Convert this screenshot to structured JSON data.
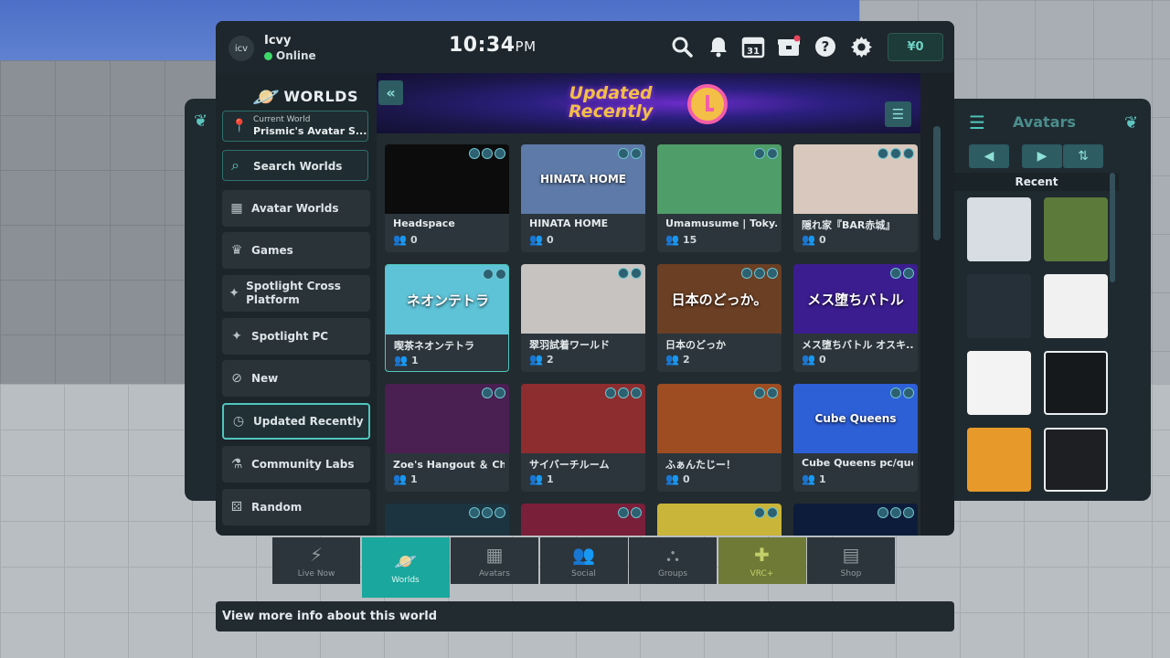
{
  "user": {
    "avatar_initials": "icv",
    "name": "Icvy",
    "status": "Online"
  },
  "clock": {
    "time": "10:34",
    "ampm": "PM"
  },
  "topbar": {
    "icons": [
      "search-icon",
      "bell-icon",
      "calendar-icon",
      "inventory-icon",
      "help-icon",
      "gear-icon"
    ],
    "calendar_day": "31",
    "credits": "0"
  },
  "sidebar": {
    "title": "WORLDS",
    "current_world_label": "Current World",
    "current_world_value": "Prismic's Avatar S...",
    "search_label": "Search Worlds",
    "items": [
      {
        "label": "Avatar Worlds",
        "icon": "book-icon",
        "active": false
      },
      {
        "label": "Games",
        "icon": "crown-icon",
        "active": false
      },
      {
        "label": "Spotlight Cross Platform",
        "icon": "spotlight-icon",
        "active": false
      },
      {
        "label": "Spotlight PC",
        "icon": "spotlight-icon",
        "active": false
      },
      {
        "label": "New",
        "icon": "new-icon",
        "active": false
      },
      {
        "label": "Updated Recently",
        "icon": "history-icon",
        "active": true
      },
      {
        "label": "Community Labs",
        "icon": "flask-icon",
        "active": false
      },
      {
        "label": "Random",
        "icon": "dice-icon",
        "active": false
      }
    ]
  },
  "banner": {
    "title_line1": "Updated",
    "title_line2": "Recently"
  },
  "worlds": [
    {
      "name": "Headspace",
      "count": "0",
      "thumb_text": "",
      "bg": "#0c0c0d"
    },
    {
      "name": "HINATA HOME",
      "count": "0",
      "thumb_text": "HINATA HOME",
      "bg": "#5d7aa8"
    },
    {
      "name": "Umamusume | Toky...",
      "count": "15",
      "thumb_text": "",
      "bg": "#4f9d68"
    },
    {
      "name": "隠れ家『BAR赤城』",
      "count": "0",
      "thumb_text": "",
      "bg": "#d9c8bd"
    },
    {
      "name": "喫茶ネオンテトラ",
      "count": "1",
      "thumb_text": "ネオンテトラ",
      "bg": "#5fc3d8"
    },
    {
      "name": "翠羽試着ワールド",
      "count": "2",
      "thumb_text": "",
      "bg": "#c7c3c0"
    },
    {
      "name": "日本のどっか",
      "count": "2",
      "thumb_text": "日本のどっか。",
      "bg": "#6b3f24"
    },
    {
      "name": "メス堕ちバトル オスキ...",
      "count": "0",
      "thumb_text": "メス堕ちバトル",
      "bg": "#3b1d8f"
    },
    {
      "name": "Zoe's Hangout ＆ Chill",
      "count": "1",
      "thumb_text": "",
      "bg": "#4a1f52"
    },
    {
      "name": "サイバーチルーム",
      "count": "1",
      "thumb_text": "",
      "bg": "#8e2d2f"
    },
    {
      "name": "ふぁんたじー！",
      "count": "0",
      "thumb_text": "",
      "bg": "#9e4d22"
    },
    {
      "name": "Cube Queens pc/ques...",
      "count": "1",
      "thumb_text": "Cube Queens",
      "bg": "#2d5fd6"
    },
    {
      "name": "",
      "count": "",
      "thumb_text": "",
      "bg": "#1c3440"
    },
    {
      "name": "",
      "count": "",
      "thumb_text": "",
      "bg": "#7a1f3a"
    },
    {
      "name": "",
      "count": "",
      "thumb_text": "",
      "bg": "#c9b53a"
    },
    {
      "name": "",
      "count": "",
      "thumb_text": "",
      "bg": "#0d1c3a"
    }
  ],
  "avatars": {
    "title": "Avatars",
    "recent_label": "Recent",
    "tiles": [
      {
        "bg": "#d8dde4",
        "selected": false
      },
      {
        "bg": "#5c7a3a",
        "selected": false
      },
      {
        "bg": "#263038",
        "selected": false
      },
      {
        "bg": "#f1f1f1",
        "selected": false
      },
      {
        "bg": "#f3f3f3",
        "selected": false
      },
      {
        "bg": "#16191c",
        "selected": true
      },
      {
        "bg": "#e79a2a",
        "selected": false
      },
      {
        "bg": "#1d1f22",
        "selected": true
      }
    ]
  },
  "bottom_nav": [
    {
      "label": "Live Now",
      "icon": "lightning-icon",
      "active": false
    },
    {
      "label": "Worlds",
      "icon": "planet-icon",
      "active": true
    },
    {
      "label": "Avatars",
      "icon": "avatar-book-icon",
      "active": false
    },
    {
      "label": "Social",
      "icon": "people-icon",
      "active": false
    },
    {
      "label": "Groups",
      "icon": "groups-icon",
      "active": false
    },
    {
      "label": "VRC+",
      "icon": "vrc-plus-icon",
      "active": false
    },
    {
      "label": "Shop",
      "icon": "shop-icon",
      "active": false
    }
  ],
  "info_bar": "View more info about this world"
}
